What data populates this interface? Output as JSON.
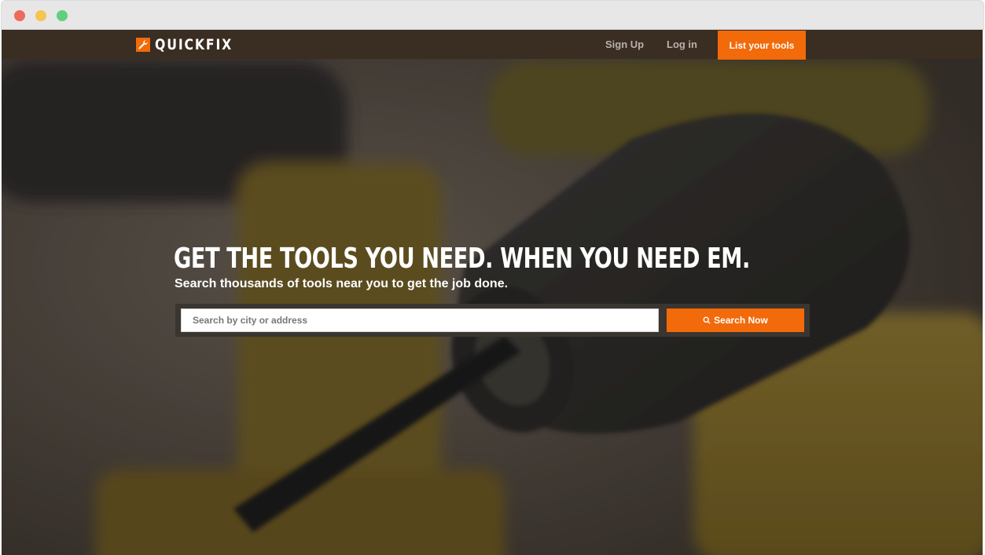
{
  "brand": {
    "name": "QUICKFIX",
    "icon": "wrench-icon",
    "color": "#f26a0a"
  },
  "nav": {
    "signup_label": "Sign Up",
    "login_label": "Log in",
    "cta_label": "List your tools"
  },
  "hero": {
    "headline": "GET THE TOOLS YOU NEED. WHEN YOU NEED EM.",
    "subhead": "Search thousands of tools near you to get the job done."
  },
  "search": {
    "placeholder": "Search by city or address",
    "value": "",
    "button_label": "Search Now",
    "button_icon": "search-icon"
  },
  "colors": {
    "accent": "#f26a0a",
    "navbar": "#3a2d22"
  }
}
